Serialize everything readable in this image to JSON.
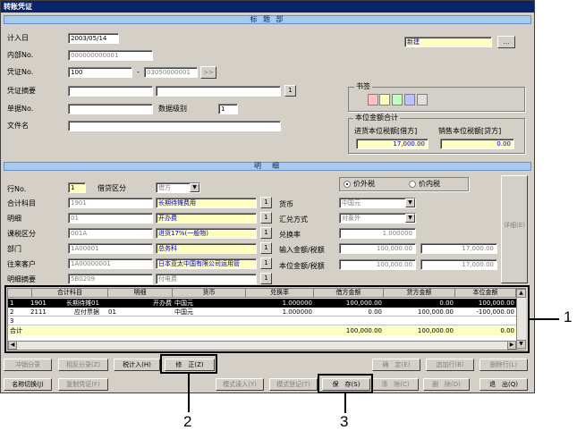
{
  "window": {
    "title": "转账凭证"
  },
  "header_band": "标 题 部",
  "detail_band": "明　细",
  "header": {
    "date_label": "计入日",
    "date_value": "2003/05/14",
    "internal_no_label": "内部No.",
    "internal_no_value": "000000000001",
    "voucher_no_label": "凭证No.",
    "voucher_no_value": "100",
    "voucher_no_value2": "03050000001",
    "voucher_sep": "-",
    "voucher_next": ">>",
    "summary_label": "凭证摘要",
    "summary_btn": "1",
    "docno_label": "单据No.",
    "level_label": "数据级别",
    "level_value": "1",
    "filename_label": "文件名",
    "status_value": "新建",
    "status_btn": "..."
  },
  "bookmark": {
    "title": "书签",
    "colors": [
      "#ffc0c0",
      "#ffffc0",
      "#c0ffc0",
      "#c0c0ff",
      "#e0e0e0"
    ]
  },
  "totals": {
    "title": "本位金额合计",
    "input_tax_label": "进货本位税额[借方]",
    "input_tax_value": "17,000.00",
    "output_tax_label": "销售本位税额[贷方]",
    "output_tax_value": "0.00"
  },
  "detail": {
    "line_label": "行No.",
    "line_value": "1",
    "dc_label": "借贷区分",
    "dc_value": "借方",
    "account_label": "合计科目",
    "account_code": "1901",
    "account_name": "长期待摊费用",
    "sub_label": "明细",
    "sub_code": "01",
    "sub_name": "开办费",
    "tax_label": "课税区分",
    "tax_code": "001A",
    "tax_name": "进货17%(一般物)",
    "dept_label": "部门",
    "dept_code": "1A00001",
    "dept_name": "总务科",
    "customer_label": "往来客户",
    "customer_code": "1A00000001",
    "customer_name": "日本亚太中国有限公司运用管",
    "desc_label": "明细摘要",
    "desc_code": "5B0209",
    "desc_name": "付电费",
    "pick_btn": "1",
    "tax_ext_label": "价外税",
    "tax_int_label": "价内税",
    "currency_label": "货币",
    "currency_value": "中国元",
    "exch_method_label": "汇兑方式",
    "exch_method_value": "对象外",
    "exch_rate_label": "兑换率",
    "exch_rate_value": "1.000000",
    "input_amount_label": "输入金额/税额",
    "input_amount_value": "100,000.00",
    "input_tax_value": "17,000.00",
    "base_amount_label": "本位金额/税额",
    "base_amount_value": "100,000.00",
    "base_tax_value": "17,000.00",
    "detail_btn": "详细(E)"
  },
  "grid": {
    "headers": [
      "",
      "合计科目",
      "明细",
      "货币",
      "兑换率",
      "借方金额",
      "贷方金额",
      "本位金额"
    ],
    "rows": [
      [
        "1",
        "1901",
        "长期待摊01",
        "开办费",
        "中国元",
        "1.000000",
        "100,000.00",
        "0.00",
        "100,000.00"
      ],
      [
        "2",
        "2111",
        "应付票据",
        "01",
        "中国元",
        "1.000000",
        "0.00",
        "100,000.00",
        "-100,000.00"
      ],
      [
        "3",
        "",
        "",
        "",
        "",
        "",
        "",
        "",
        ""
      ]
    ],
    "total_label": "合计",
    "total_debit": "100,000.00",
    "total_credit": "100,000.00",
    "total_base": "0.00"
  },
  "buttons": {
    "offset": "冲销分录",
    "opposite": "相反分录(Z)",
    "tax_calc": "税计入(H)",
    "modify": "修　正(Z)",
    "confirm": "确　定(E)",
    "add_row": "追加行(B)",
    "delete_row": "删除行(L)",
    "name_switch": "名称切换(J)",
    "copy": "复制凭证(F)",
    "pattern_load": "模式读入(Y)",
    "pattern_save": "模式登记(T)",
    "save": "保　存(S)",
    "clear": "清　除(C)",
    "delete": "删　除(D)",
    "exit": "退　出(Q)"
  },
  "callouts": {
    "c1": "1",
    "c2": "2",
    "c3": "3"
  }
}
